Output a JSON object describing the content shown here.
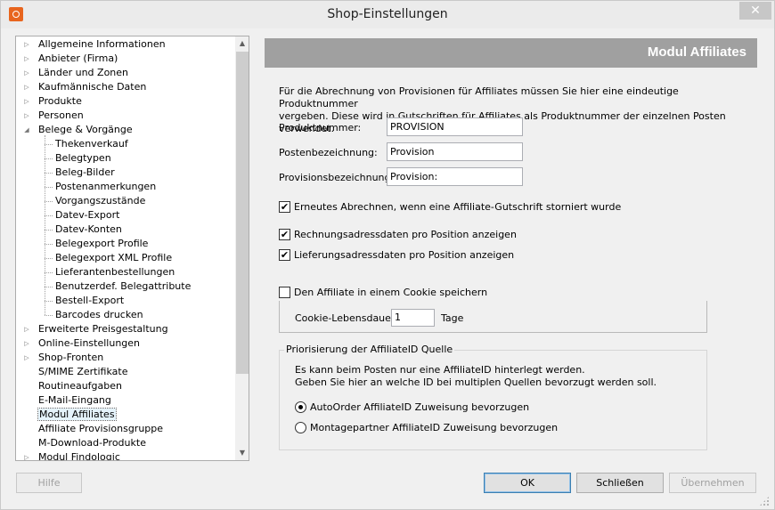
{
  "window": {
    "title": "Shop-Einstellungen",
    "close_glyph": "✕"
  },
  "tree": {
    "items": [
      {
        "label": "Allgemeine Informationen",
        "expandable": true
      },
      {
        "label": "Anbieter (Firma)",
        "expandable": true
      },
      {
        "label": "Länder und Zonen",
        "expandable": true
      },
      {
        "label": "Kaufmännische Daten",
        "expandable": true
      },
      {
        "label": "Produkte",
        "expandable": true
      },
      {
        "label": "Personen",
        "expandable": true
      },
      {
        "label": "Belege & Vorgänge",
        "expandable": true,
        "expanded": true
      },
      {
        "label": "Thekenverkauf",
        "child": true
      },
      {
        "label": "Belegtypen",
        "child": true
      },
      {
        "label": "Beleg-Bilder",
        "child": true
      },
      {
        "label": "Postenanmerkungen",
        "child": true
      },
      {
        "label": "Vorgangszustände",
        "child": true
      },
      {
        "label": "Datev-Export",
        "child": true
      },
      {
        "label": "Datev-Konten",
        "child": true
      },
      {
        "label": "Belegexport Profile",
        "child": true
      },
      {
        "label": "Belegexport XML Profile",
        "child": true
      },
      {
        "label": "Lieferantenbestellungen",
        "child": true
      },
      {
        "label": "Benutzerdef. Belegattribute",
        "child": true
      },
      {
        "label": "Bestell-Export",
        "child": true
      },
      {
        "label": "Barcodes drucken",
        "child": true
      },
      {
        "label": "Erweiterte Preisgestaltung",
        "expandable": true
      },
      {
        "label": "Online-Einstellungen",
        "expandable": true
      },
      {
        "label": "Shop-Fronten",
        "expandable": true
      },
      {
        "label": "S/MIME Zertifikate"
      },
      {
        "label": "Routineaufgaben"
      },
      {
        "label": "E-Mail-Eingang"
      },
      {
        "label": "Modul Affiliates",
        "selected": true
      },
      {
        "label": "Affiliate Provisionsgruppe"
      },
      {
        "label": "M-Download-Produkte"
      },
      {
        "label": "Modul Findologic",
        "expandable": true
      }
    ]
  },
  "panel": {
    "title": "Modul Affiliates",
    "description_line1": "Für die Abrechnung von Provisionen für Affiliates müssen Sie hier eine eindeutige Produktnummer",
    "description_line2": "vergeben. Diese wird in Gutschriften für Affiliates als Produktnummer der einzelnen Posten verwendet.",
    "fields": [
      {
        "label": "Produktnummer:",
        "value": "PROVISION"
      },
      {
        "label": "Postenbezeichnung:",
        "value": "Provision"
      },
      {
        "label": "Provisionsbezeichnung:",
        "value": "Provision:"
      }
    ],
    "checkboxes": [
      {
        "label": "Erneutes Abrechnen, wenn eine Affiliate-Gutschrift storniert wurde",
        "checked": true
      },
      {
        "label": "Rechnungsadressdaten pro Position anzeigen",
        "checked": true
      },
      {
        "label": "Lieferungsadressdaten pro Position anzeigen",
        "checked": true
      },
      {
        "label": "Den Affiliate in einem Cookie speichern",
        "checked": false
      }
    ],
    "check_glyph": "✔",
    "cookie": {
      "label": "Cookie-Lebensdauer:",
      "value": "1",
      "unit": "Tage"
    },
    "priority": {
      "legend": "Priorisierung der AffiliateID Quelle",
      "text_line1": "Es kann beim Posten nur eine AffiliateID hinterlegt werden.",
      "text_line2": "Geben Sie hier an welche ID bei multiplen Quellen bevorzugt werden soll.",
      "options": [
        {
          "label": "AutoOrder AffiliateID Zuweisung bevorzugen",
          "selected": true
        },
        {
          "label": "Montagepartner AffiliateID Zuweisung bevorzugen",
          "selected": false
        }
      ]
    }
  },
  "buttons": {
    "help": "Hilfe",
    "ok": "OK",
    "close": "Schließen",
    "apply": "Übernehmen"
  },
  "scroll": {
    "up_glyph": "▲",
    "down_glyph": "▼"
  }
}
